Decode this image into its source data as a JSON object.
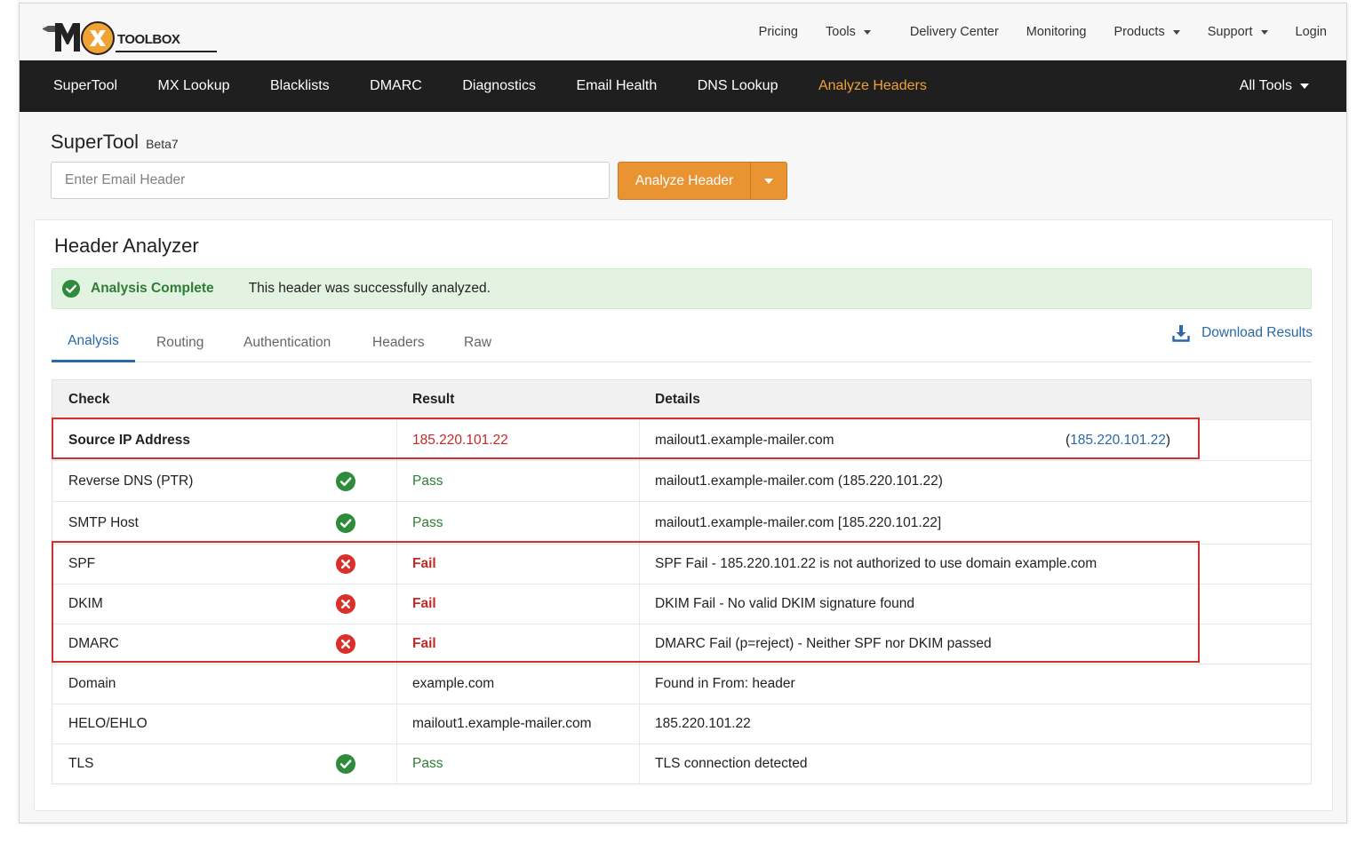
{
  "brand": {
    "logo_text": "TOOLBOX",
    "logo_mark": "MX",
    "accent": "#f0a235",
    "nav_bg": "#1f1f1f"
  },
  "topnav": {
    "items": [
      {
        "label": "Pricing",
        "dropdown": false
      },
      {
        "label": "Tools",
        "dropdown": true
      },
      {
        "label": "Delivery Center",
        "dropdown": false
      },
      {
        "label": "Monitoring",
        "dropdown": false
      },
      {
        "label": "Products",
        "dropdown": true
      },
      {
        "label": "Support",
        "dropdown": true
      },
      {
        "label": "Login",
        "dropdown": false
      }
    ]
  },
  "mainnav": {
    "links": [
      "SuperTool",
      "MX Lookup",
      "Blacklists",
      "DMARC",
      "Diagnostics",
      "Email Health",
      "DNS Lookup",
      "Analyze Headers"
    ],
    "active": "Analyze Headers",
    "all_tools": "All Tools"
  },
  "supertool": {
    "title": "SuperTool",
    "beta": "Beta7",
    "input_placeholder": "Enter Email Header",
    "input_value": "",
    "button_label": "Analyze Header"
  },
  "analyzer": {
    "title": "Header Analyzer",
    "alert_strong": "Analysis Complete",
    "alert_message": "This header was successfully analyzed.",
    "tabs": [
      "Analysis",
      "Routing",
      "Authentication",
      "Headers",
      "Raw"
    ],
    "active_tab": "Analysis",
    "download_label": "Download Results"
  },
  "table": {
    "headers": {
      "check": "Check",
      "result": "Result",
      "details": "Details"
    },
    "rows": [
      {
        "check": "Source IP Address",
        "status": "",
        "result": "185.220.101.22",
        "details": "mailout1.example-mailer.com",
        "extra": "185.220.101.22"
      },
      {
        "check": "Reverse DNS (PTR)",
        "status": "pass",
        "result": "Pass",
        "details": "mailout1.example-mailer.com (185.220.101.22)"
      },
      {
        "check": "SMTP Host",
        "status": "pass",
        "result": "Pass",
        "details": "mailout1.example-mailer.com [185.220.101.22]"
      },
      {
        "check": "SPF",
        "status": "fail",
        "result": "Fail",
        "details": "SPF Fail - 185.220.101.22 is not authorized to use domain example.com"
      },
      {
        "check": "DKIM",
        "status": "fail",
        "result": "Fail",
        "details": "DKIM Fail - No valid DKIM signature found"
      },
      {
        "check": "DMARC",
        "status": "fail",
        "result": "Fail",
        "details": "DMARC Fail (p=reject) - Neither SPF nor DKIM passed"
      },
      {
        "check": "Domain",
        "status": "",
        "result": "example.com",
        "details": "Found in From: header"
      },
      {
        "check": "HELO/EHLO",
        "status": "",
        "result": "mailout1.example-mailer.com",
        "details": "185.220.101.22"
      },
      {
        "check": "TLS",
        "status": "pass",
        "result": "Pass",
        "details": "TLS connection detected"
      }
    ]
  },
  "colors": {
    "pass": "#2e7d32",
    "fail": "#c62828",
    "link": "#2a68a8",
    "highlight": "#d32f2f",
    "button": "#ea9332"
  }
}
